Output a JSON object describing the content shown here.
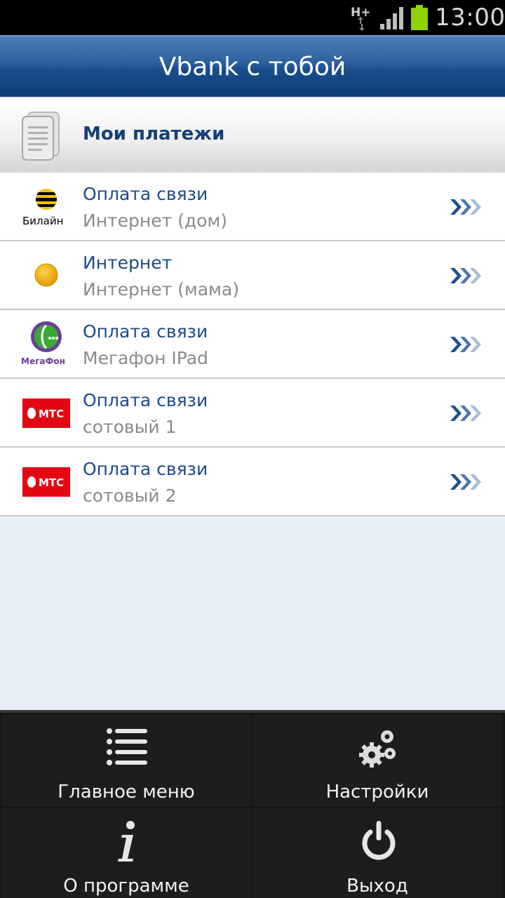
{
  "status": {
    "network": "H+",
    "time": "13:00"
  },
  "header": {
    "title": "Vbank с тобой"
  },
  "section": {
    "title": "Мои платежи"
  },
  "payments": [
    {
      "logo": "beeline-logo",
      "logo_text": "Билайн",
      "title": "Оплата связи",
      "subtitle": "Интернет (дом)"
    },
    {
      "logo": "orange-dot-icon",
      "title": "Интернет",
      "subtitle": "Интернет (мама)"
    },
    {
      "logo": "megafon-logo",
      "logo_text": "МегаФон",
      "title": "Оплата связи",
      "subtitle": "Мегафон IPad"
    },
    {
      "logo": "mts-logo",
      "logo_text": "МТС",
      "title": "Оплата связи",
      "subtitle": "сотовый 1"
    },
    {
      "logo": "mts-logo",
      "logo_text": "МТС",
      "title": "Оплата связи",
      "subtitle": "сотовый 2"
    }
  ],
  "menu": {
    "main_menu": "Главное меню",
    "settings": "Настройки",
    "about": "О программе",
    "exit": "Выход"
  },
  "colors": {
    "accent": "#1b4a8a",
    "header": "#1a4d8c",
    "battery": "#8fd400",
    "mts_red": "#e30613"
  }
}
